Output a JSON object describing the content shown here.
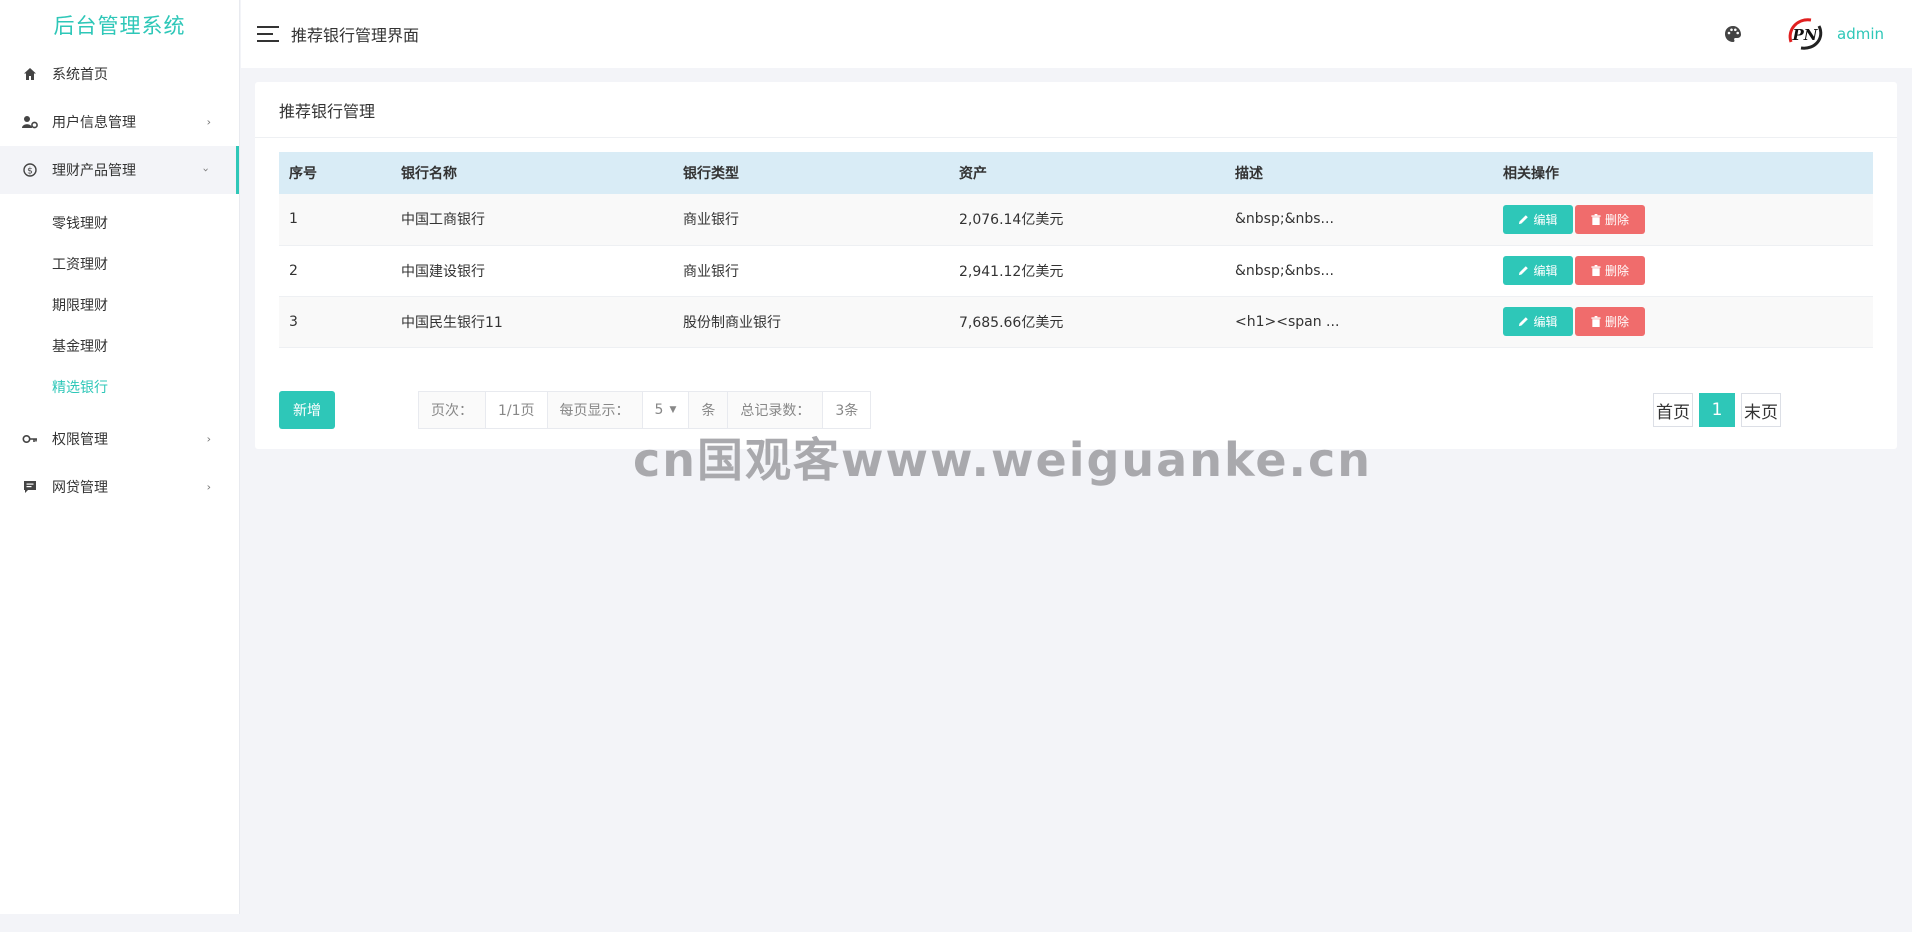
{
  "sidebar": {
    "brand": "后台管理系统",
    "items": [
      {
        "label": "系统首页",
        "icon": "home-icon"
      },
      {
        "label": "用户信息管理",
        "icon": "user-settings-icon",
        "arrow": "›"
      },
      {
        "label": "理财产品管理",
        "icon": "finance-icon",
        "arrow": "›",
        "open": true,
        "children": [
          {
            "label": "零钱理财"
          },
          {
            "label": "工资理财"
          },
          {
            "label": "期限理财"
          },
          {
            "label": "基金理财"
          },
          {
            "label": "精选银行",
            "active": true
          }
        ]
      },
      {
        "label": "权限管理",
        "icon": "key-icon",
        "arrow": "›"
      },
      {
        "label": "网贷管理",
        "icon": "message-icon",
        "arrow": "›"
      }
    ]
  },
  "header": {
    "title": "推荐银行管理界面",
    "user": "admin",
    "avatar_text": "PN"
  },
  "card": {
    "title": "推荐银行管理"
  },
  "table": {
    "headers": [
      "序号",
      "银行名称",
      "银行类型",
      "资产",
      "描述",
      "相关操作"
    ],
    "rows": [
      {
        "id": "1",
        "name": "中国工商银行",
        "type": "商业银行",
        "assets": "2,076.14亿美元",
        "desc": "&nbsp;&nbs..."
      },
      {
        "id": "2",
        "name": "中国建设银行",
        "type": "商业银行",
        "assets": "2,941.12亿美元",
        "desc": "&nbsp;&nbs..."
      },
      {
        "id": "3",
        "name": "中国民生银行11",
        "type": "股份制商业银行",
        "assets": "7,685.66亿美元",
        "desc": "<h1><span ..."
      }
    ],
    "edit_label": "编辑",
    "delete_label": "删除"
  },
  "footer": {
    "add_label": "新增",
    "page_label": "页次：",
    "page_value": "1/1页",
    "per_page_label": "每页显示：",
    "per_page_value": "5",
    "per_page_unit": "条",
    "total_label": "总记录数：",
    "total_value": "3条",
    "first_label": "首页",
    "current_page": "1",
    "last_label": "末页"
  },
  "watermark": "cn国观客www.weiguanke.cn",
  "colors": {
    "accent": "#2ec7b8",
    "danger": "#f06c6c",
    "table_header": "#d9ecf6",
    "background": "#f3f4f8"
  }
}
